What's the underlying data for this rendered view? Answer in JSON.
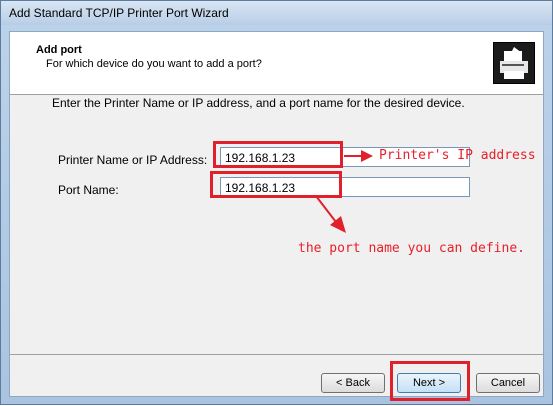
{
  "window": {
    "title": "Add Standard TCP/IP Printer Port Wizard"
  },
  "header": {
    "title": "Add port",
    "subtitle": "For which device do you want to add a port?",
    "icon": "printer-port-icon"
  },
  "main": {
    "instruction": "Enter the Printer Name or IP address, and a port name for the desired device.",
    "printer_label": "Printer Name or IP Address:",
    "printer_value": "192.168.1.23",
    "port_label": "Port Name:",
    "port_value": "192.168.1.23"
  },
  "annotations": {
    "ip_note": "Printer's IP address",
    "port_note": "the port name you can define.",
    "color": "#e0202a"
  },
  "buttons": {
    "back": "< Back",
    "next": "Next >",
    "cancel": "Cancel"
  }
}
